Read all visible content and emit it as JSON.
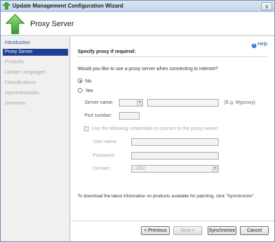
{
  "window": {
    "title": "Update Management Configuration Wizard",
    "close_glyph": "x"
  },
  "header": {
    "title": "Proxy Server"
  },
  "sidebar": {
    "items": [
      {
        "label": "Introduction"
      },
      {
        "label": "Proxy Server"
      },
      {
        "label": "Products"
      },
      {
        "label": "Update Languages"
      },
      {
        "label": "Classifications"
      },
      {
        "label": "Synchronization"
      },
      {
        "label": "Summary"
      }
    ]
  },
  "main": {
    "help_label": "Help",
    "section_title": "Specify proxy if required:",
    "question": "Would you like to use a proxy server when connecting to internet?",
    "radio_no": "No",
    "radio_yes": "Yes",
    "selected_option": "No",
    "server_name_label": "Server name:",
    "server_name_example": "(E.g. Myproxy)",
    "port_number_label": "Port number:",
    "credentials_label": "Use the following credentials to connect to the proxy server:",
    "user_name_label": "User name:",
    "password_label": "Password:",
    "domain_label": "Domain:",
    "domain_value": "LAB2",
    "info_text": "To download the latest information on products available for patching, click \"Synchronize\"."
  },
  "buttons": {
    "previous": "< Previous",
    "next": "Next >",
    "synchronize": "Synchronize",
    "cancel": "Cancel"
  },
  "colors": {
    "accent": "#1f3f94",
    "link": "#2a51a8",
    "disabled_text": "#a6a6a6"
  }
}
